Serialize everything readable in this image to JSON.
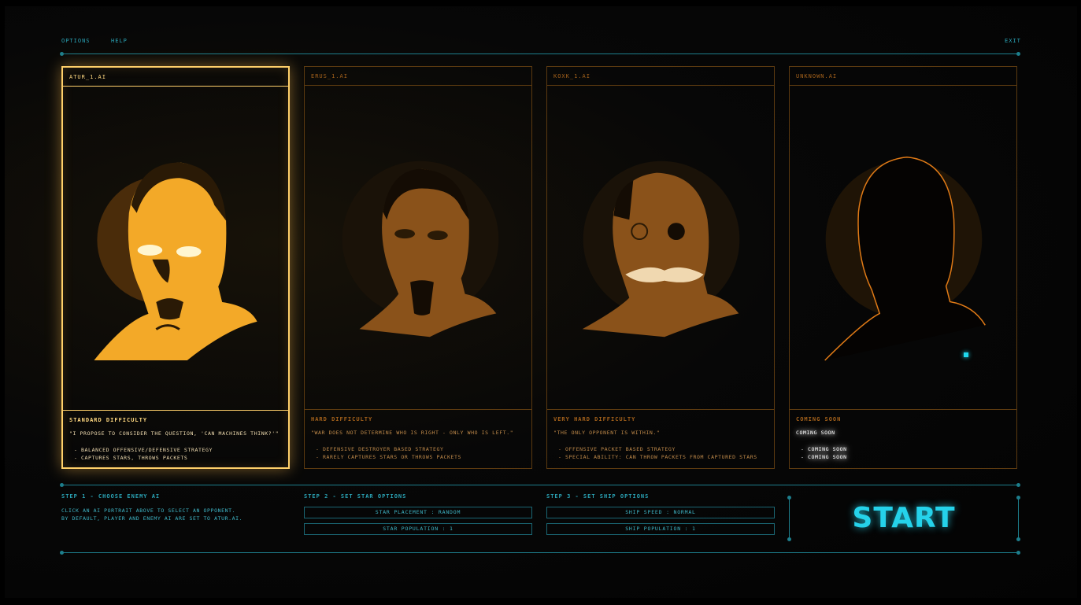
{
  "menu": {
    "options": "OPTIONS",
    "help": "HELP",
    "exit": "EXIT"
  },
  "cards": [
    {
      "name": "ATUR_1.AI",
      "difficulty": "STANDARD DIFFICULTY",
      "quote": "\"I PROPOSE TO CONSIDER THE QUESTION, 'CAN MACHINES THINK?'\"",
      "traits": [
        "- BALANCED OFFENSIVE/DEFENSIVE STRATEGY",
        "- CAPTURES STARS, THROWS PACKETS"
      ]
    },
    {
      "name": "ERUS_1.AI",
      "difficulty": "HARD DIFFICULTY",
      "quote": "\"WAR DOES NOT DETERMINE WHO IS RIGHT - ONLY WHO IS LEFT.\"",
      "traits": [
        "- DEFENSIVE DESTROYER BASED STRATEGY",
        "- RARELY CAPTURES STARS OR THROWS PACKETS"
      ]
    },
    {
      "name": "KOXK_1.AI",
      "difficulty": "VERY HARD DIFFICULTY",
      "quote": "\"THE ONLY OPPONENT IS WITHIN.\"",
      "traits": [
        "- OFFENSIVE PACKET BASED STRATEGY",
        "- SPECIAL ABILITY: CAN THROW PACKETS FROM CAPTURED STARS"
      ]
    },
    {
      "name": "UNKNOWN.AI",
      "difficulty": "COMING SOON",
      "quote": "COMING SOON",
      "traits": [
        "- COMING SOON",
        "- COMING SOON"
      ]
    }
  ],
  "steps": {
    "step1": {
      "label": "STEP 1 - CHOOSE ENEMY AI",
      "desc1": "CLICK AN AI PORTRAIT ABOVE TO SELECT AN OPPONENT.",
      "desc2": "BY DEFAULT, PLAYER AND ENEMY AI ARE SET TO ATUR.AI."
    },
    "step2": {
      "label": "STEP 2 - SET STAR OPTIONS",
      "placement": "STAR PLACEMENT : RANDOM",
      "population": "STAR POPULATION : 1"
    },
    "step3": {
      "label": "STEP 3 - SET SHIP OPTIONS",
      "speed": "SHIP SPEED : NORMAL",
      "population": "SHIP POPULATION : 1"
    }
  },
  "start_label": "START",
  "colors": {
    "accent_cyan": "#25d2ea",
    "selected_gold": "#ffd06a",
    "card_orange": "#a5621b"
  }
}
